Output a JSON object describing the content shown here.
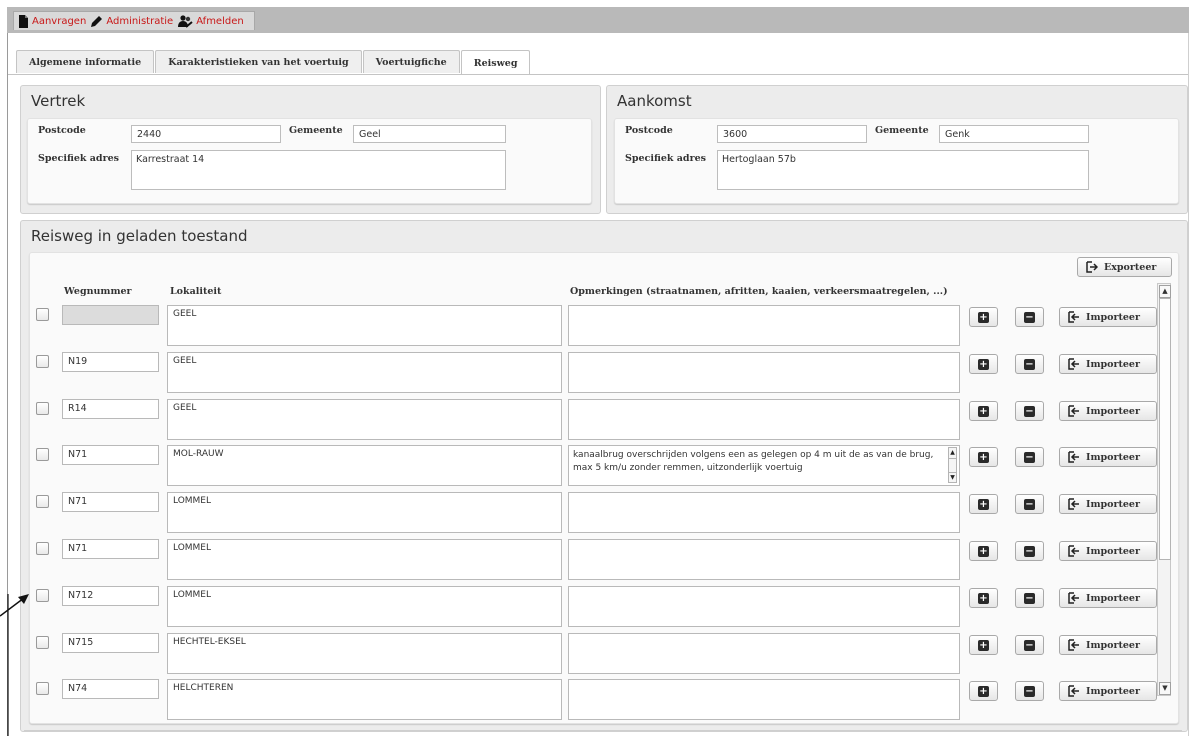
{
  "topbar": {
    "items": [
      {
        "label": "Aanvragen",
        "icon": "document-icon"
      },
      {
        "label": "Administratie",
        "icon": "pencil-icon"
      },
      {
        "label": "Afmelden",
        "icon": "users-icon"
      }
    ],
    "accent": "#c81818"
  },
  "tabs": [
    {
      "label": "Algemene informatie"
    },
    {
      "label": "Karakteristieken van het voertuig"
    },
    {
      "label": "Voertuigfiche"
    },
    {
      "label": "Reisweg"
    }
  ],
  "vertrek": {
    "title": "Vertrek",
    "postcode_label": "Postcode",
    "postcode": "2440",
    "gemeente_label": "Gemeente",
    "gemeente": "Geel",
    "adres_label": "Specifiek adres",
    "adres": "Karrestraat 14"
  },
  "aankomst": {
    "title": "Aankomst",
    "postcode_label": "Postcode",
    "postcode": "3600",
    "gemeente_label": "Gemeente",
    "gemeente": "Genk",
    "adres_label": "Specifiek adres",
    "adres": "Hertoglaan 57b"
  },
  "reisweg": {
    "title": "Reisweg in geladen toestand",
    "export_label": "Exporteer",
    "columns": {
      "wegnummer": "Wegnummer",
      "lokaliteit": "Lokaliteit",
      "opmerkingen": "Opmerkingen (straatnamen, afritten, kaaien, verkeersmaatregelen, ...)"
    },
    "import_label": "Importeer",
    "add_glyph": "+",
    "remove_glyph": "−",
    "rows": [
      {
        "wegnummer": "",
        "lokaliteit": "GEEL",
        "opmerkingen": "",
        "disabled": true
      },
      {
        "wegnummer": "N19",
        "lokaliteit": "GEEL",
        "opmerkingen": ""
      },
      {
        "wegnummer": "R14",
        "lokaliteit": "GEEL",
        "opmerkingen": ""
      },
      {
        "wegnummer": "N71",
        "lokaliteit": "MOL-RAUW",
        "opmerkingen": "kanaalbrug overschrijden volgens een as gelegen op 4 m uit de as van de brug, max 5 km/u zonder remmen, uitzonderlijk voertuig",
        "scroll": true
      },
      {
        "wegnummer": "N71",
        "lokaliteit": "LOMMEL",
        "opmerkingen": ""
      },
      {
        "wegnummer": "N71",
        "lokaliteit": "LOMMEL",
        "opmerkingen": ""
      },
      {
        "wegnummer": "N712",
        "lokaliteit": "LOMMEL",
        "opmerkingen": ""
      },
      {
        "wegnummer": "N715",
        "lokaliteit": "HECHTEL-EKSEL",
        "opmerkingen": ""
      },
      {
        "wegnummer": "N74",
        "lokaliteit": "HELCHTEREN",
        "opmerkingen": ""
      }
    ]
  }
}
